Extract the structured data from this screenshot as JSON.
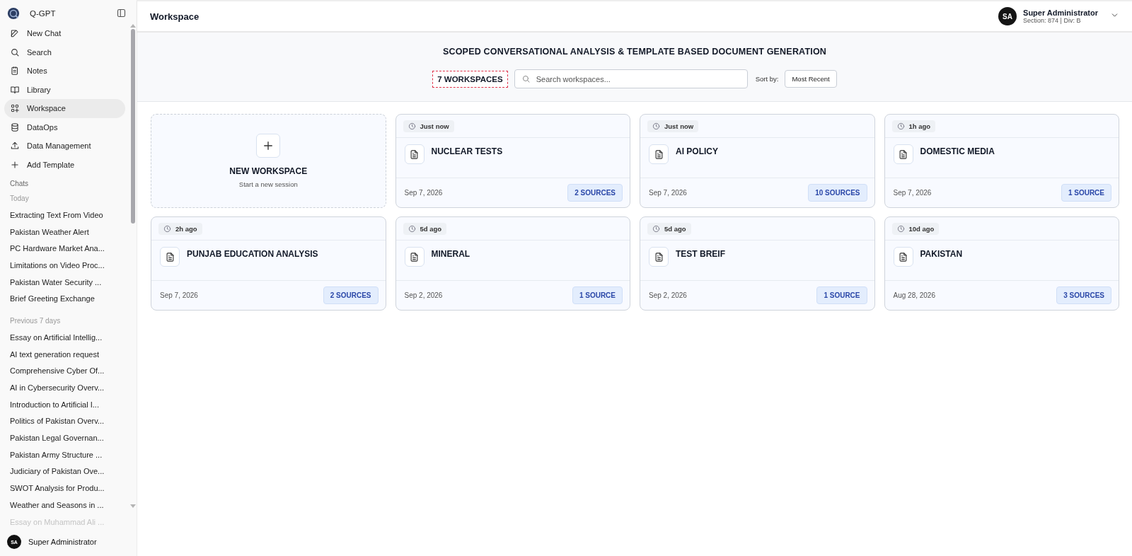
{
  "app": {
    "name": "Q-GPT"
  },
  "nav": [
    {
      "label": "New Chat",
      "selected": false
    },
    {
      "label": "Search",
      "selected": false
    },
    {
      "label": "Notes",
      "selected": false
    },
    {
      "label": "Library",
      "selected": false
    },
    {
      "label": "Workspace",
      "selected": true
    },
    {
      "label": "DataOps",
      "selected": false
    },
    {
      "label": "Data Management",
      "selected": false
    },
    {
      "label": "Add Template",
      "selected": false
    }
  ],
  "chats_heading": "Chats",
  "chat_groups": [
    {
      "heading": "Today",
      "items": [
        {
          "title": "Extracting Text From Video",
          "faded": false
        },
        {
          "title": "Pakistan Weather Alert",
          "faded": false
        },
        {
          "title": "PC Hardware Market Ana...",
          "faded": false
        },
        {
          "title": "Limitations on Video Proc...",
          "faded": false
        },
        {
          "title": "Pakistan Water Security ...",
          "faded": false
        },
        {
          "title": "Brief Greeting Exchange",
          "faded": false
        }
      ]
    },
    {
      "heading": "Previous 7 days",
      "items": [
        {
          "title": "Essay on Artificial Intellig...",
          "faded": false
        },
        {
          "title": "AI text generation request",
          "faded": false
        },
        {
          "title": "Comprehensive Cyber Of...",
          "faded": false
        },
        {
          "title": "AI in Cybersecurity Overv...",
          "faded": false
        },
        {
          "title": "Introduction to Artificial I...",
          "faded": false
        },
        {
          "title": "Politics of Pakistan Overv...",
          "faded": false
        },
        {
          "title": "Pakistan Legal Governan...",
          "faded": false
        },
        {
          "title": "Pakistan Army Structure ...",
          "faded": false
        },
        {
          "title": "Judiciary of Pakistan Ove...",
          "faded": false
        },
        {
          "title": "SWOT Analysis for Produ...",
          "faded": false
        },
        {
          "title": "Weather and Seasons in ...",
          "faded": false
        },
        {
          "title": "Essay on Muhammad Ali ...",
          "faded": true
        }
      ]
    }
  ],
  "sidebar_user": {
    "initials": "SA",
    "name": "Super Administrator"
  },
  "header": {
    "title": "Workspace",
    "user": {
      "initials": "SA",
      "name": "Super Administrator",
      "detail": "Section: 874 | Div: B"
    }
  },
  "banner": {
    "heading": "SCOPED CONVERSATIONAL ANALYSIS & TEMPLATE BASED DOCUMENT GENERATION",
    "count": "7 WORKSPACES",
    "search": {
      "placeholder": "Search workspaces..."
    },
    "sort_label": "Sort by:",
    "sort_value": "Most Recent"
  },
  "new_card": {
    "title": "NEW WORKSPACE",
    "subtitle": "Start a new session"
  },
  "workspaces": [
    {
      "time": "Just now",
      "title": "NUCLEAR TESTS",
      "date": "Sep 7, 2026",
      "sources": "2 SOURCES"
    },
    {
      "time": "Just now",
      "title": "AI POLICY",
      "date": "Sep 7, 2026",
      "sources": "10 SOURCES"
    },
    {
      "time": "1h ago",
      "title": "DOMESTIC MEDIA",
      "date": "Sep 7, 2026",
      "sources": "1 SOURCE"
    },
    {
      "time": "2h ago",
      "title": "PUNJAB EDUCATION ANALYSIS",
      "date": "Sep 7, 2026",
      "sources": "2 SOURCES"
    },
    {
      "time": "5d ago",
      "title": "MINERAL",
      "date": "Sep 2, 2026",
      "sources": "1 SOURCE"
    },
    {
      "time": "5d ago",
      "title": "TEST BREIF",
      "date": "Sep 2, 2026",
      "sources": "1 SOURCE"
    },
    {
      "time": "10d ago",
      "title": "PAKISTAN",
      "date": "Aug 28, 2026",
      "sources": "3 SOURCES"
    }
  ]
}
